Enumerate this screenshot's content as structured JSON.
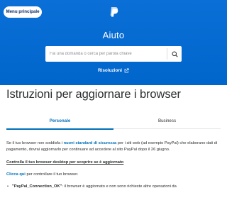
{
  "header": {
    "menu_label": "Menu principale",
    "logo_icon": "paypal-logo-icon",
    "title": "Aiuto",
    "search_placeholder": "Fai una domanda o cerca per parola chiave",
    "search_icon": "search-icon",
    "resolution_label": "Risoluzioni",
    "resolution_icon": "external-link-icon",
    "brand_color": "#0070e0"
  },
  "page": {
    "title": "Istruzioni per aggiornare i browser",
    "tabs": [
      {
        "label": "Personale",
        "active": true
      },
      {
        "label": "Business",
        "active": false
      }
    ]
  },
  "content": {
    "p1_before": "Se il tuo browser non soddisfa i ",
    "p1_link": "nuovi standard di sicurezza",
    "p1_after": " per i siti web (ad esempio PayPal) che elaborano dati di pagamento, dovrai aggiornarlo per continuare ad accedere al sito PayPal dopo il 26 giugno.",
    "p2": "Controlla il tuo browser desktop per scoprire se è aggiornato",
    "p3_link": "Clicca qui",
    "p3_after": " per controllare il tuo browser.",
    "bullet_strong": "\"PayPal_Connection_OK\"",
    "bullet_after": ": il browser è aggiornato e non sono richieste altre operazioni da"
  }
}
